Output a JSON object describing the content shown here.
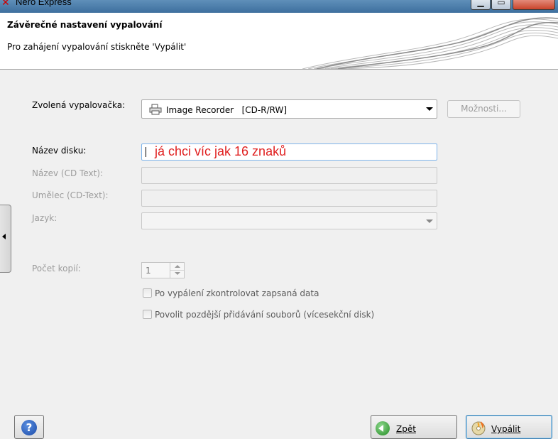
{
  "window": {
    "title": "Nero Express"
  },
  "header": {
    "title": "Závěrečné nastavení vypalování",
    "subtitle": "Pro zahájení vypalování stiskněte 'Vypálit'"
  },
  "form": {
    "recorder_label": "Zvolená vypalovačka:",
    "recorder_value": "Image Recorder   [CD-R/RW]",
    "options_button": "Možnosti...",
    "disc_name_label": "Název disku:",
    "disc_name_value": "já chci víc jak 16 znaků",
    "cd_text_title_label": "Název (CD Text):",
    "cd_text_artist_label": "Umělec (CD-Text):",
    "language_label": "Jazyk:",
    "copies_label": "Počet kopií:",
    "copies_value": "1",
    "verify_label": "Po vypálení zkontrolovat zapsaná data",
    "multisession_label": "Povolit pozdější přidávání souborů (vícesekční disk)"
  },
  "footer": {
    "help_glyph": "?",
    "back_label": "Zpět",
    "burn_label": "Vypálit"
  },
  "colors": {
    "disc_name_text": "#e02020",
    "focus_border": "#7eb4ea"
  }
}
